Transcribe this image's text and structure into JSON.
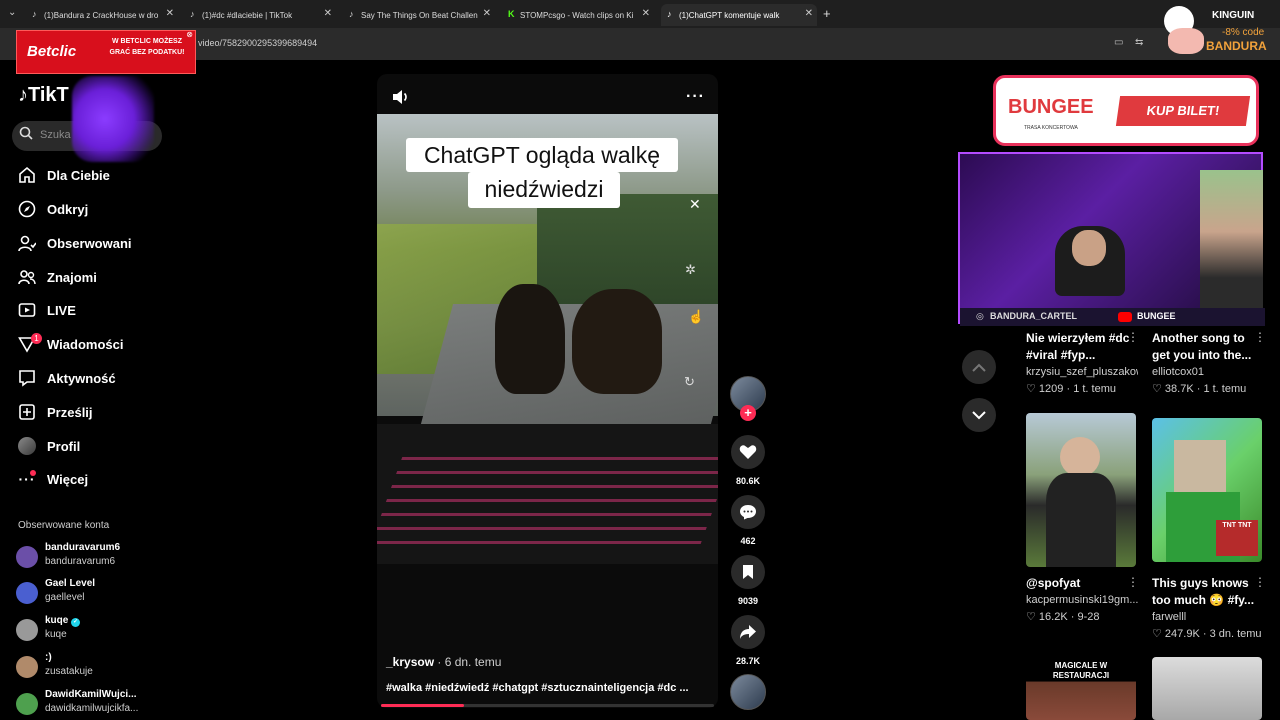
{
  "browser": {
    "tabs": [
      {
        "title": "(1)Bandura z CrackHouse w dro",
        "active": false
      },
      {
        "title": "(1)#dc #dlaciebie | TikTok",
        "active": false
      },
      {
        "title": "Say The Things On Beat Challen",
        "active": false
      },
      {
        "title": "STOMPcsgo - Watch clips on Ki",
        "active": false
      },
      {
        "title": "(1)ChatGPT komentuje walk",
        "active": true
      }
    ],
    "new_tab": "+",
    "url": "video/7582900295399689494"
  },
  "ads": {
    "betclic": {
      "logo": "Betclic",
      "tagline": "W BETCLIC MOŻESZ GRAĆ BEZ PODATKU!"
    },
    "kinguin": {
      "brand": "KINGUIN",
      "discount": "-8% code",
      "code": "BANDURA"
    },
    "bungee": {
      "title": "BUNGEE",
      "subtitle": "TRASA KONCERTOWA",
      "cta": "KUP BILET!"
    }
  },
  "stream_overlay": {
    "handle": "BANDURA_CARTEL",
    "brand": "BUNGEE"
  },
  "sidebar": {
    "logo": "TikT",
    "search_placeholder": "Szuka",
    "nav": [
      {
        "label": "Dla Ciebie",
        "icon": "home-icon"
      },
      {
        "label": "Odkryj",
        "icon": "compass-icon"
      },
      {
        "label": "Obserwowani",
        "icon": "person-follow-icon"
      },
      {
        "label": "Znajomi",
        "icon": "friends-icon"
      },
      {
        "label": "LIVE",
        "icon": "live-icon"
      },
      {
        "label": "Wiadomości",
        "icon": "inbox-icon"
      },
      {
        "label": "Aktywność",
        "icon": "activity-icon"
      },
      {
        "label": "Prześlij",
        "icon": "upload-icon"
      },
      {
        "label": "Profil",
        "icon": "avatar-icon"
      },
      {
        "label": "Więcej",
        "icon": "more-icon"
      }
    ],
    "messages_badge": "1",
    "followed_title": "Obserwowane konta",
    "followed": [
      {
        "name": "banduravarum6",
        "handle": "banduravarum6",
        "color": "#6b4fa8"
      },
      {
        "name": "Gael Level",
        "handle": "gaellevel",
        "color": "#4a5fd0"
      },
      {
        "name": "kuqe",
        "handle": "kuqe",
        "color": "#999999"
      },
      {
        "name": ":)",
        "handle": "zusatakuje",
        "color": "#b08a6a"
      },
      {
        "name": "DawidKamilWujci...",
        "handle": "dawidkamilwujcikfa...",
        "color": "#4ea04e"
      }
    ]
  },
  "video": {
    "caption_line1": "ChatGPT ogląda walkę",
    "caption_line2": "niedźwiedzi",
    "author": "_krysow",
    "date": " · 6 dn. temu",
    "hashtags": "#walka #niedźwiedź #chatgpt #sztucznainteligencja #dc ...",
    "progress": 0.25
  },
  "actions": {
    "likes": "80.6K",
    "comments": "462",
    "saves": "9039",
    "shares": "28.7K"
  },
  "recommendations": [
    {
      "title": "Nie wierzyłem #dc #viral #fyp...",
      "user": "krzysiu_szef_pluszakow",
      "likes": "1209",
      "date": "1 t. temu"
    },
    {
      "title": "Another song to get you into the...",
      "user": "elliotcox01",
      "likes": "38.7K",
      "date": "1 t. temu"
    },
    {
      "title": "@spofyat",
      "user": "kacpermusinski19gm...",
      "likes": "16.2K",
      "date": "9-28"
    },
    {
      "title": "This guys knows too much 😳 #fy...",
      "user": "farwelll",
      "likes": "247.9K",
      "date": "3 dn. temu"
    }
  ],
  "thumb_text": {
    "magicale": "MAGICALE W RESTAURACJI",
    "tnt": "TNT TNT"
  },
  "colors": {
    "accent": "#fe2c55",
    "betclic": "#d80f1c",
    "bungee": "#e03a3e",
    "stream_border": "#b44cff"
  }
}
